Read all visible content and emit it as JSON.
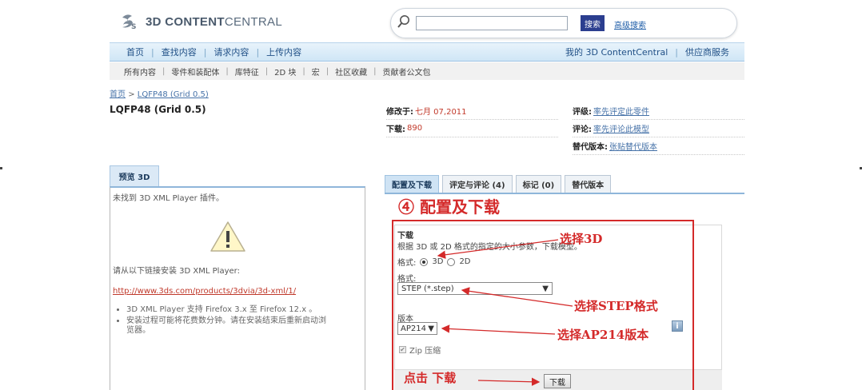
{
  "header": {
    "logo_text_bold": "3D CONTENT",
    "logo_text_rest": "CENTRAL",
    "search_value": "",
    "search_button": "搜索",
    "advanced_search": "高级搜索"
  },
  "nav": {
    "primary": [
      "首页",
      "查找内容",
      "请求内容",
      "上传内容"
    ],
    "right": [
      "我的 3D ContentCentral",
      "供应商服务"
    ],
    "secondary": [
      "所有内容",
      "零件和装配体",
      "库特征",
      "2D 块",
      "宏",
      "社区收藏",
      "贡献者公文包"
    ]
  },
  "breadcrumb": {
    "home": "首页",
    "separator": ">",
    "current": "LQFP48 (Grid 0.5)"
  },
  "page_title": "LQFP48 (Grid 0.5)",
  "info": {
    "modified_label": "修改于:",
    "modified_value": "七月 07,2011",
    "downloads_label": "下载:",
    "downloads_value": "890",
    "rating_label": "评级:",
    "rating_value": "率先评定此零件",
    "review_label": "评论:",
    "review_value": "率先评论此模型",
    "alt_label": "替代版本:",
    "alt_value": "张贴替代版本"
  },
  "preview": {
    "tab": "预览 3D",
    "not_found": "未找到 3D XML Player 插件。",
    "install_text": "请从以下链接安装 3D XML Player:",
    "link": "http://www.3ds.com/products/3dvia/3d-xml/1/",
    "bullets": [
      "3D XML Player 支持 Firefox 3.x 至 Firefox 12.x 。",
      "安装过程可能将花费数分钟。请在安装结束后重新启动浏览器。"
    ]
  },
  "tabs": [
    "配置及下载",
    "评定与评论 (4)",
    "标记 (0)",
    "替代版本"
  ],
  "step_title": "④  配置及下载",
  "download": {
    "heading": "下载",
    "description": "根据 3D 或 2D 格式的指定的大小参数，下载模型。",
    "format_label": "格式:",
    "option_3d": "3D",
    "option_2d": "2D",
    "format_label2": "格式:",
    "format_value": "STEP (*.step)",
    "version_label": "版本",
    "version_value": "AP214",
    "zip_label": "Zip 压缩",
    "button": "下载"
  },
  "annotations": {
    "select_3d": "选择3D",
    "select_step": "选择STEP格式",
    "select_ap214": "选择AP214版本",
    "click_download": "点击  下载"
  },
  "colors": {
    "annotation_red": "#d42a2a",
    "nav_blue": "#cfe6f6",
    "search_button": "#2b3e8f"
  }
}
